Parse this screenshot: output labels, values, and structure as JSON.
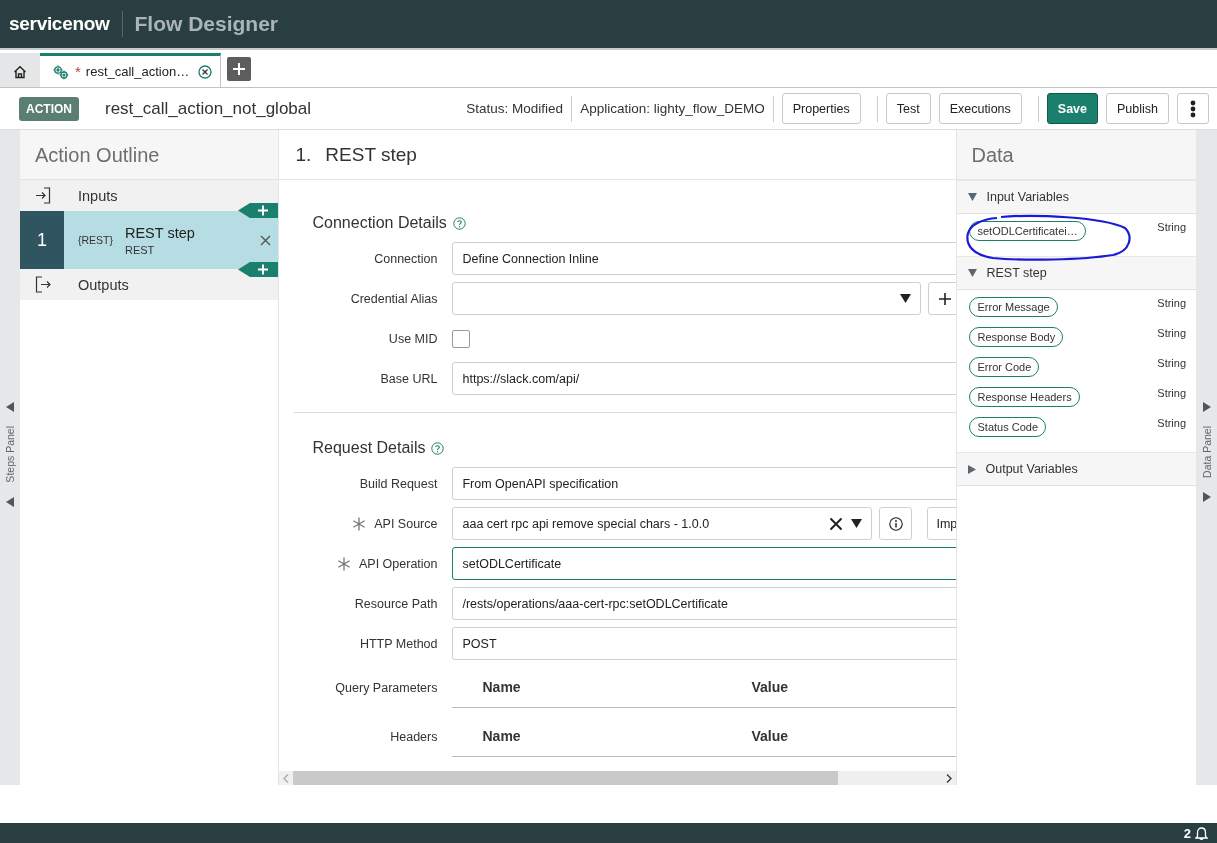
{
  "header": {
    "logo": "servicenow",
    "product": "Flow Designer"
  },
  "tabs": [
    {
      "kind": "home",
      "selected": false
    },
    {
      "kind": "document",
      "label": "rest_call_action…",
      "unsaved_mark": "*",
      "selected": true
    }
  ],
  "action_bar": {
    "badge": "ACTION",
    "name": "rest_call_action_not_global",
    "status": "Status: Modified",
    "application": "Application: lighty_flow_DEMO",
    "button_groups": [
      [
        {
          "kind": "default",
          "label": "Properties"
        }
      ],
      [
        {
          "kind": "default",
          "label": "Test"
        },
        {
          "kind": "default",
          "label": "Executions"
        }
      ],
      [
        {
          "kind": "primary",
          "label": "Save"
        },
        {
          "kind": "default",
          "label": "Publish"
        },
        {
          "kind": "more"
        }
      ]
    ]
  },
  "steps_panel": {
    "label": "Steps Panel"
  },
  "outline": {
    "title": "Action Outline",
    "items": [
      {
        "kind": "inputs",
        "label": "Inputs"
      },
      {
        "kind": "step",
        "number": "1",
        "tag": "{REST}",
        "label": "REST step",
        "sublabel": "REST",
        "selected": true
      },
      {
        "kind": "outputs",
        "label": "Outputs"
      }
    ]
  },
  "step": {
    "number": "1.",
    "title": "REST step",
    "sections": [
      {
        "title": "Connection Details",
        "fields": [
          {
            "kind": "text",
            "label": "Connection",
            "value": "Define Connection Inline"
          },
          {
            "kind": "select-add",
            "label": "Credential Alias"
          },
          {
            "kind": "checkbox",
            "label": "Use MID",
            "checked": false
          },
          {
            "kind": "text",
            "label": "Base URL",
            "value": "https://slack.com/api/"
          }
        ]
      },
      {
        "title": "Request Details",
        "fields": [
          {
            "kind": "text",
            "label": "Build Request",
            "value": "From OpenAPI specification"
          },
          {
            "kind": "select-clear",
            "label": "API Source",
            "value": "aaa cert rpc api remove special chars - 1.0.0",
            "extra_button": "Imp",
            "required": true
          },
          {
            "kind": "text",
            "label": "API Operation",
            "value": "setODLCertificate",
            "required": true,
            "focused": true
          },
          {
            "kind": "text",
            "label": "Resource Path",
            "value": "/rests/operations/aaa-cert-rpc:setODLCertificate"
          },
          {
            "kind": "text",
            "label": "HTTP Method",
            "value": "POST"
          },
          {
            "kind": "table",
            "label": "Query Parameters",
            "columns": [
              "Name",
              "Value"
            ]
          },
          {
            "kind": "table",
            "label": "Headers",
            "columns": [
              "Name",
              "Value"
            ]
          }
        ]
      }
    ]
  },
  "data": {
    "title": "Data",
    "groups": [
      {
        "label": "Input Variables",
        "expanded": true,
        "items": [
          {
            "name": "setODLCertificatei…",
            "type": "String"
          }
        ]
      },
      {
        "label": "REST step",
        "expanded": true,
        "items": [
          {
            "name": "Error Message",
            "type": "String"
          },
          {
            "name": "Response Body",
            "type": "String"
          },
          {
            "name": "Error Code",
            "type": "String"
          },
          {
            "name": "Response Headers",
            "type": "String"
          },
          {
            "name": "Status Code",
            "type": "String"
          }
        ]
      },
      {
        "label": "Output Variables",
        "expanded": false
      }
    ]
  },
  "data_panel": {
    "label": "Data Panel"
  },
  "footer": {
    "count": "2"
  }
}
